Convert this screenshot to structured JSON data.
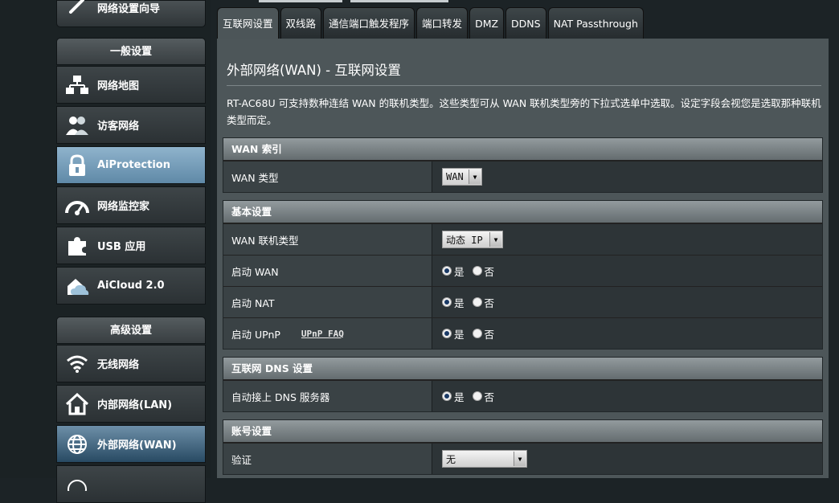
{
  "sidebar": {
    "top_item": "网络设置向导",
    "general_header": "一般设置",
    "general_items": [
      {
        "label": "网络地图",
        "icon": "network-map-icon"
      },
      {
        "label": "访客网络",
        "icon": "guest-network-icon"
      },
      {
        "label": "AiProtection",
        "icon": "lock-icon"
      },
      {
        "label": "网络监控家",
        "icon": "speedometer-icon"
      },
      {
        "label": "USB 应用",
        "icon": "puzzle-icon"
      },
      {
        "label": "AiCloud 2.0",
        "icon": "cloud-house-icon"
      }
    ],
    "advanced_header": "高级设置",
    "advanced_items": [
      {
        "label": "无线网络",
        "icon": "wifi-icon"
      },
      {
        "label": "内部网络(LAN)",
        "icon": "home-icon"
      },
      {
        "label": "外部网络(WAN)",
        "icon": "globe-icon"
      }
    ]
  },
  "tabs": [
    "互联网设置",
    "双线路",
    "通信端口触发程序",
    "端口转发",
    "DMZ",
    "DDNS",
    "NAT Passthrough"
  ],
  "main": {
    "title": "外部网络(WAN) - 互联网设置",
    "description": "RT-AC68U 可支持数种连结 WAN 的联机类型。这些类型可从 WAN 联机类型旁的下拉式选单中选取。设定字段会视您是选取那种联机类型而定。",
    "sections": {
      "wan_index": {
        "header": "WAN 索引",
        "wan_type_label": "WAN 类型",
        "wan_type_value": "WAN"
      },
      "basic": {
        "header": "基本设置",
        "conn_type_label": "WAN 联机类型",
        "conn_type_value": "动态 IP",
        "enable_wan_label": "启动 WAN",
        "enable_nat_label": "启动 NAT",
        "enable_upnp_label": "启动 UPnP",
        "upnp_faq": "UPnP FAQ"
      },
      "dns": {
        "header": "互联网 DNS 设置",
        "auto_dns_label": "自动接上 DNS 服务器"
      },
      "account": {
        "header": "账号设置",
        "auth_label": "验证",
        "auth_value": "无"
      }
    },
    "yes": "是",
    "no": "否"
  },
  "colors": {
    "accent_active": "#7fa4bf",
    "active_wan": "#2f5574",
    "panel_bg": "#4d5659",
    "section_header": "#7d8588"
  }
}
